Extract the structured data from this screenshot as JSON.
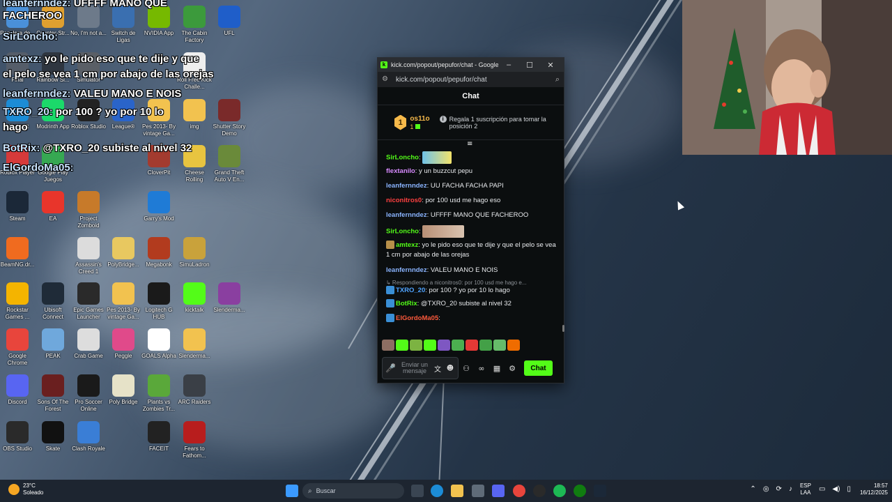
{
  "desktop": {
    "icons": [
      {
        "label": "Papelera de...",
        "icon": "recycle-bin-icon",
        "color": "#4a90d9"
      },
      {
        "label": "Counter-Str...",
        "icon": "counter-strike-icon",
        "color": "#e0a030"
      },
      {
        "label": "No, I'm not a...",
        "icon": "game-icon",
        "color": "#6d7a8a"
      },
      {
        "label": "Switch de Ligas",
        "icon": "switch-icon",
        "color": "#3a6fb0"
      },
      {
        "label": "NVIDIA App",
        "icon": "nvidia-icon",
        "color": "#76b900"
      },
      {
        "label": "The Cabin Factory",
        "icon": "frog-icon",
        "color": "#3c9a3c"
      },
      {
        "label": "UFL",
        "icon": "ufl-icon",
        "color": "#1f5ec9"
      },
      {
        "label": "Final",
        "icon": "game-icon",
        "color": "#555d69"
      },
      {
        "label": "Rainbow Si...",
        "icon": "rainbow-six-icon",
        "color": "#2f3640"
      },
      {
        "label": "Simulator",
        "icon": "game-icon",
        "color": "#5a5f66"
      },
      {
        "label": "League®",
        "icon": "rocket-league-icon",
        "color": "#2a64c9"
      },
      {
        "label": "Roll Free Kick Challe...",
        "icon": "football-icon",
        "color": "#eeeeee"
      },
      {
        "label": "Microsoft",
        "icon": "edge-icon",
        "color": "#1c8cd6"
      },
      {
        "label": "Modrinth App",
        "icon": "modrinth-icon",
        "color": "#1bd96a"
      },
      {
        "label": "Roblox Studio",
        "icon": "roblox-icon",
        "color": "#222222"
      },
      {
        "label": "Pes 2013- By vintage Ga...",
        "icon": "folder-icon",
        "color": "#f2c24f"
      },
      {
        "label": "Pes 2013- By vintage Ga...",
        "icon": "folder-icon",
        "color": "#f2c24f"
      },
      {
        "label": "img",
        "icon": "folder-icon",
        "color": "#f2c24f"
      },
      {
        "label": "Shutter Story Demo",
        "icon": "game-icon",
        "color": "#7a2a2a"
      },
      {
        "label": "Roblox Player",
        "icon": "roblox-icon",
        "color": "#d63a3a"
      },
      {
        "label": "Google Play Juegos",
        "icon": "play-games-icon",
        "color": "#36a852"
      },
      {
        "label": "CloverPit",
        "icon": "game-icon",
        "color": "#a33b2f"
      },
      {
        "label": "Cheese Rolling",
        "icon": "cheese-icon",
        "color": "#e8c440"
      },
      {
        "label": "Grand Theft Auto V En...",
        "icon": "gta-icon",
        "color": "#6a8a3a"
      },
      {
        "label": "Steam",
        "icon": "steam-icon",
        "color": "#1b2838"
      },
      {
        "label": "EA",
        "icon": "ea-icon",
        "color": "#e8352b"
      },
      {
        "label": "Project Zomboid",
        "icon": "zomboid-icon",
        "color": "#c77a2a"
      },
      {
        "label": "Garry's Mod",
        "icon": "gmod-icon",
        "color": "#1f7bd6"
      },
      {
        "label": "BeamNG.dr...",
        "icon": "beamng-icon",
        "color": "#f06b1f"
      },
      {
        "label": "Assassin's Creed 1",
        "icon": "assassins-creed-icon",
        "color": "#dcdcdc"
      },
      {
        "label": "Megabonk",
        "icon": "megabonk-icon",
        "color": "#b23b1e"
      },
      {
        "label": "SimuLadron",
        "icon": "coin-icon",
        "color": "#c9a23b"
      },
      {
        "label": "Rockstar Games ...",
        "icon": "rockstar-icon",
        "color": "#f4b400"
      },
      {
        "label": "Ubisoft Connect",
        "icon": "ubisoft-icon",
        "color": "#1f2b38"
      },
      {
        "label": "Epic Games Launcher",
        "icon": "epic-icon",
        "color": "#2a2a2a"
      },
      {
        "label": "Peggle",
        "icon": "peggle-icon",
        "color": "#e04a8a"
      },
      {
        "label": "Logitech G HUB",
        "icon": "logitech-icon",
        "color": "#1a1a1a"
      },
      {
        "label": "kicktalk",
        "icon": "kick-icon",
        "color": "#53fc18"
      },
      {
        "label": "Slenderma...",
        "icon": "winrar-icon",
        "color": "#8a3fa0"
      },
      {
        "label": "Google Chrome",
        "icon": "chrome-icon",
        "color": "#e8453c"
      },
      {
        "label": "PEAK",
        "icon": "peak-icon",
        "color": "#6fa8dc"
      },
      {
        "label": "Crab Game",
        "icon": "crab-icon",
        "color": "#dddddd"
      },
      {
        "label": "Poly Bridge",
        "icon": "polybridge-icon",
        "color": "#e6e2c8"
      },
      {
        "label": "GOALS Alpha",
        "icon": "goals-icon",
        "color": "#ffffff"
      },
      {
        "label": "Slenderma...",
        "icon": "folder-icon",
        "color": "#f2c24f"
      },
      {
        "label": "Discord",
        "icon": "discord-icon",
        "color": "#5865f2"
      },
      {
        "label": "Sons Of The Forest",
        "icon": "sotf-icon",
        "color": "#6a1f1f"
      },
      {
        "label": "Pro Soccer Online",
        "icon": "soccer-icon",
        "color": "#1a1a1a"
      },
      {
        "label": "PolyBridge...",
        "icon": "folder-icon",
        "color": "#e8c860"
      },
      {
        "label": "Plants vs Zombies Tr...",
        "icon": "pvz-icon",
        "color": "#5aa83a"
      },
      {
        "label": "ARC Raiders",
        "icon": "arc-icon",
        "color": "#3a3f46"
      },
      {
        "label": "OBS Studio",
        "icon": "obs-icon",
        "color": "#2a2a2a"
      },
      {
        "label": "Skate",
        "icon": "skate-icon",
        "color": "#111111"
      },
      {
        "label": "Clash Royale",
        "icon": "clash-icon",
        "color": "#3a7ed6"
      },
      {
        "label": "FACEIT",
        "icon": "faceit-icon",
        "color": "#222222"
      },
      {
        "label": "Fears to Fathom...",
        "icon": "f2f-icon",
        "color": "#b81d1d"
      }
    ]
  },
  "overlay": {
    "lines": [
      {
        "name": "leanfernndez:",
        "text": "UFFFF MANO QUE"
      },
      {
        "name": "",
        "text": "FACHEROO"
      },
      {
        "name": "SirLoncho:",
        "text": ""
      },
      {
        "name": "amtexz:",
        "text": "yo le pido eso que te dije y que"
      },
      {
        "name": "",
        "text": "el pelo se vea 1 cm por abajo de las orejas"
      },
      {
        "name": "leanfernndez:",
        "text": "VALEU MANO E NOIS"
      },
      {
        "name": "TXRO_20:",
        "text": "por 100 ? yo por 10 lo"
      },
      {
        "name": "",
        "text": "hago"
      },
      {
        "name": "BotRix:",
        "text": "@TXRO_20 subiste al nivel 32"
      },
      {
        "name": "ElGordoMa05:",
        "text": ""
      }
    ]
  },
  "chat_window": {
    "title": "kick.com/popout/pepufor/chat - Google Ch...",
    "url": "kick.com/popout/pepufor/chat",
    "header": "Chat",
    "pinned": {
      "rank": "1",
      "user": "os11o",
      "count": "1",
      "text": "Regala 1 suscripción para tomar la posición 2"
    },
    "messages": [
      {
        "user": "SirLoncho",
        "color": "#53fc18",
        "text": "",
        "emote": true
      },
      {
        "user": "flextanilo",
        "color": "#d88bff",
        "text": "y un buzzcut pepu"
      },
      {
        "user": "leanfernndez",
        "color": "#8ab4ff",
        "text": "UU FACHA FACHA PAPI"
      },
      {
        "user": "niconitros0",
        "color": "#ff4040",
        "text": "por 100 usd me hago eso"
      },
      {
        "user": "leanfernndez",
        "color": "#8ab4ff",
        "text": "UFFFF MANO QUE FACHEROO"
      },
      {
        "user": "SirLoncho",
        "color": "#53fc18",
        "text": "",
        "emote": true
      },
      {
        "user": "amtexz",
        "color": "#53fc18",
        "text": "yo le pido eso que te dije y que el pelo se vea 1 cm por abajo de las orejas"
      },
      {
        "user": "leanfernndez",
        "color": "#8ab4ff",
        "text": "VALEU MANO E NOIS"
      },
      {
        "user": "TXRO_20",
        "color": "#4fa3ff",
        "text": "por 100 ? yo por 10 lo hago",
        "reply": "Respondiendo a niconitros0: por 100 usd me hago e..."
      },
      {
        "user": "BotRix",
        "color": "#53fc18",
        "text": "@TXRO_20 subiste al nivel 32"
      },
      {
        "user": "ElGordoMa05",
        "color": "#ff5a3c",
        "text": ""
      }
    ],
    "input_placeholder": "Enviar un mensaje",
    "send_label": "Chat"
  },
  "taskbar": {
    "weather_temp": "23°C",
    "weather_desc": "Soleado",
    "search_placeholder": "Buscar",
    "lang_top": "ESP",
    "lang_bottom": "LAA",
    "time": "18:57",
    "date": "16/12/2025"
  }
}
